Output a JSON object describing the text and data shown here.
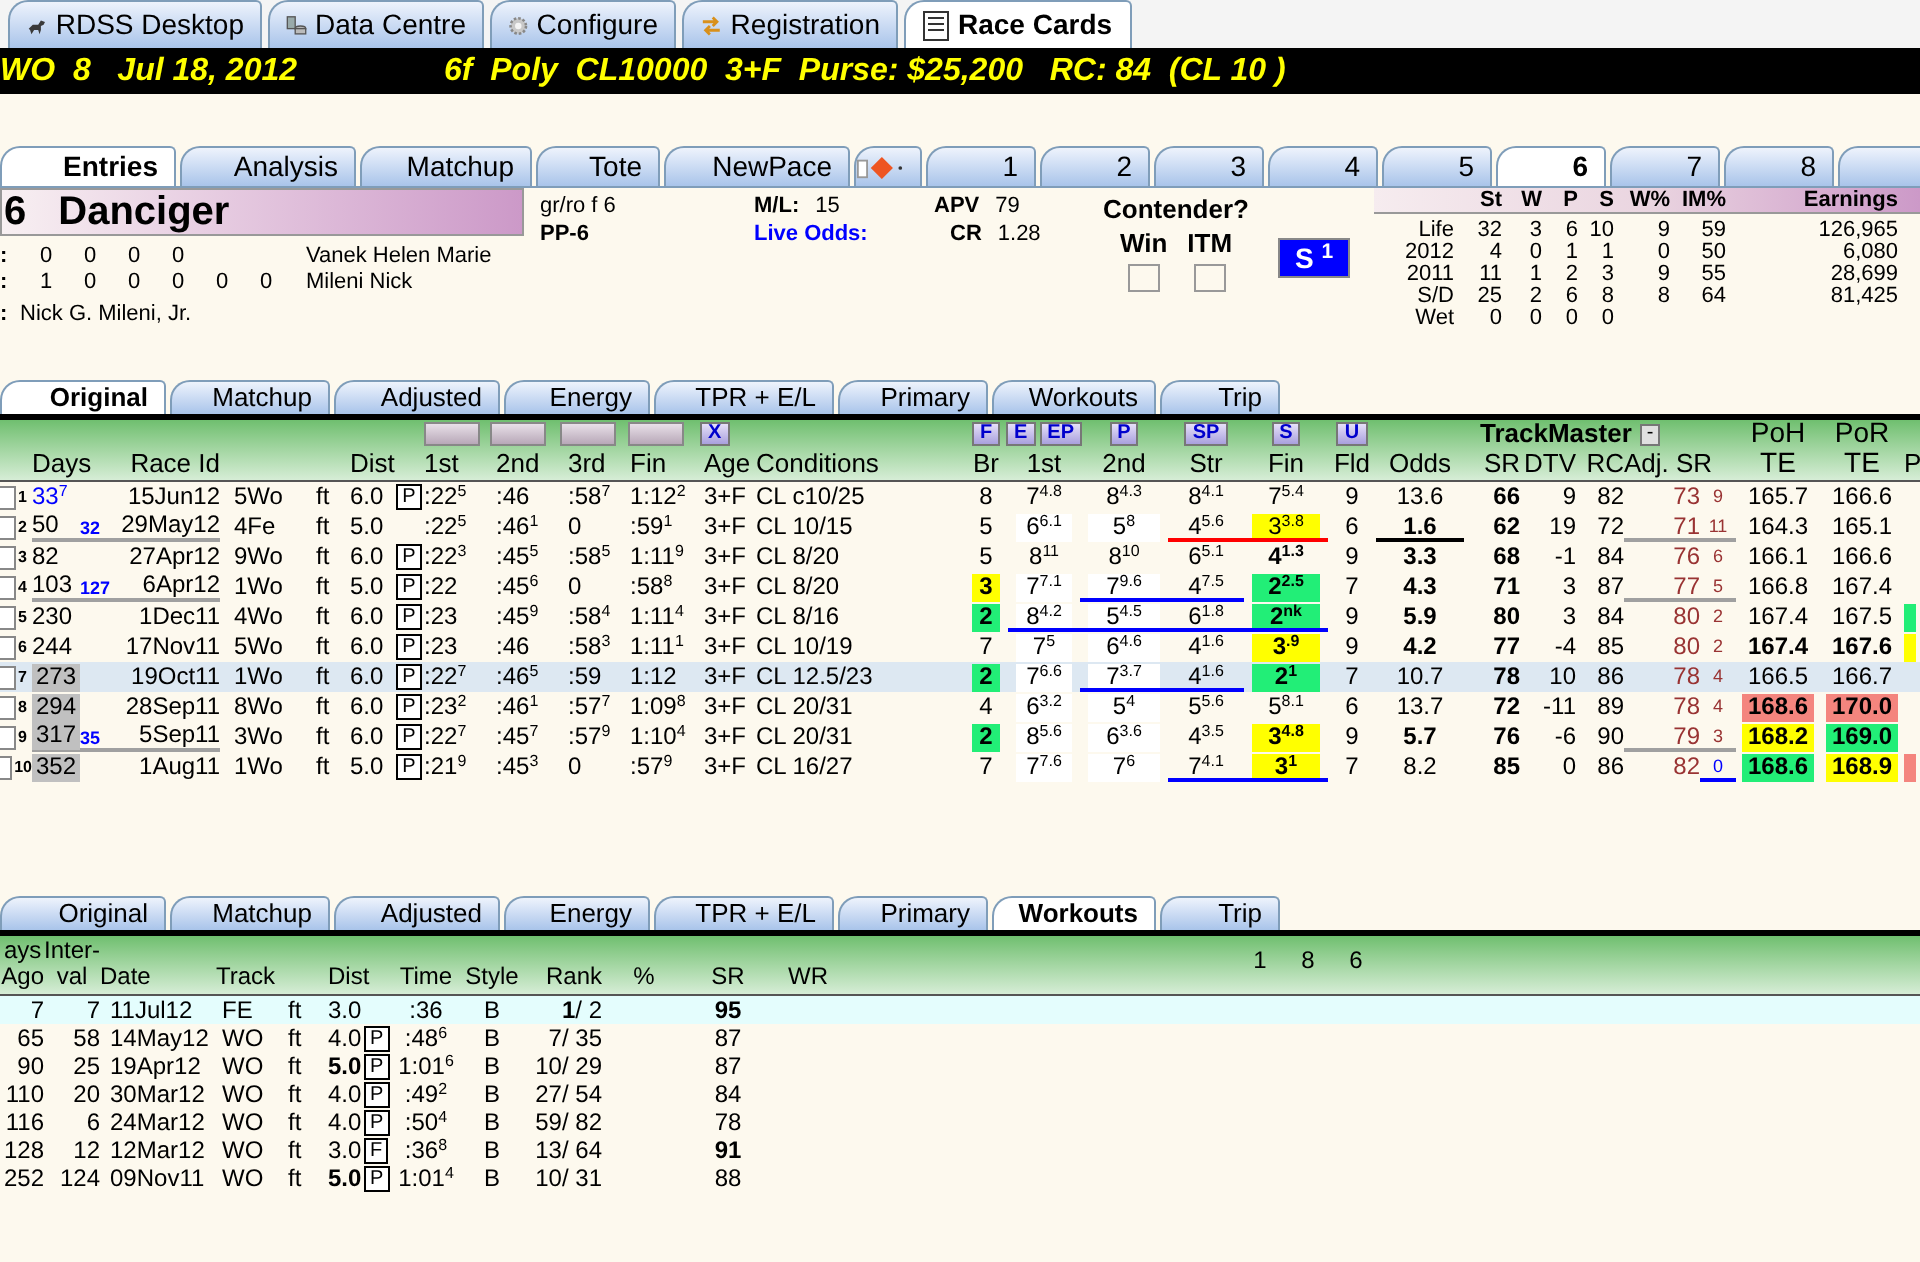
{
  "app_tabs": [
    {
      "label": "RDSS Desktop",
      "selected": false,
      "kind": "horse"
    },
    {
      "label": "Data Centre",
      "selected": false,
      "kind": "database"
    },
    {
      "label": "Configure",
      "selected": false,
      "kind": "gear"
    },
    {
      "label": "Registration",
      "selected": false,
      "kind": "arrows"
    },
    {
      "label": "Race Cards",
      "selected": true,
      "kind": "document"
    }
  ],
  "race_header": {
    "left": "WO  8   Jul 18, 2012",
    "right": "6f  Poly  CL10000  3+F  Purse: $25,200   RC: 84  (CL 10 )"
  },
  "entry_tabs": [
    {
      "kind": "text",
      "label": "Entries",
      "selected": true
    },
    {
      "kind": "text",
      "label": "Analysis",
      "selected": false
    },
    {
      "kind": "text",
      "label": "Matchup",
      "selected": false
    },
    {
      "kind": "text",
      "label": "Tote",
      "selected": false
    },
    {
      "kind": "text",
      "label": "NewPace",
      "selected": false
    },
    {
      "kind": "icon",
      "selected": false
    }
  ],
  "horse_tabs": [
    {
      "label": "1",
      "selected": false
    },
    {
      "label": "2",
      "selected": false
    },
    {
      "label": "3",
      "selected": false
    },
    {
      "label": "4",
      "selected": false
    },
    {
      "label": "5",
      "selected": false
    },
    {
      "label": "6",
      "selected": true
    },
    {
      "label": "7",
      "selected": false
    },
    {
      "label": "8",
      "selected": false
    },
    {
      "selected": false
    }
  ],
  "horse": {
    "number": "6",
    "name": "Danciger",
    "record_lines": [
      {
        "label": ":",
        "values": [
          "0",
          "0",
          "0",
          "0"
        ],
        "person": "Vanek Helen Marie"
      },
      {
        "label": ":",
        "values": [
          "1",
          "0",
          "0",
          "0",
          "0",
          "0"
        ],
        "person": "Mileni Nick"
      },
      {
        "label": ":",
        "person": "Nick G. Mileni, Jr."
      }
    ],
    "description": "gr/ro f 6",
    "post": "PP-6",
    "odds": [
      {
        "label": "M/L:",
        "value": "15"
      },
      {
        "label": "Live Odds:",
        "color": "#0000ff"
      }
    ],
    "ratings": [
      {
        "label": "APV",
        "value": "79"
      },
      {
        "label": "CR",
        "value": "1.28"
      }
    ],
    "contender": {
      "title": "Contender?",
      "options": [
        {
          "label": "Win",
          "checked": false
        },
        {
          "label": "ITM",
          "checked": false
        }
      ]
    },
    "style_badge": "S $^{1}$"
  },
  "career": {
    "columns": [
      "St",
      "W",
      "P",
      "S",
      "W%",
      "IM%",
      "Earnings"
    ],
    "rows": [
      {
        "label": "Life",
        "values": [
          "32",
          "3",
          "6",
          "10",
          "9",
          "59",
          "126,965"
        ]
      },
      {
        "label": "2012",
        "values": [
          "4",
          "0",
          "1",
          "1",
          "0",
          "50",
          "6,080"
        ]
      },
      {
        "label": "2011",
        "values": [
          "11",
          "1",
          "2",
          "3",
          "9",
          "55",
          "28,699"
        ]
      },
      {
        "label": "S/D",
        "values": [
          "25",
          "2",
          "6",
          "8",
          "8",
          "64",
          "81,425"
        ]
      },
      {
        "label": "Wet",
        "values": [
          "0",
          "0",
          "0",
          "0"
        ]
      }
    ]
  },
  "past_tabs": [
    {
      "label": "Original",
      "selected": true
    },
    {
      "label": "Matchup",
      "selected": false
    },
    {
      "label": "Adjusted",
      "selected": false
    },
    {
      "label": "Energy",
      "selected": false
    },
    {
      "label": "TPR + E/L",
      "selected": false
    },
    {
      "label": "Primary",
      "selected": false
    },
    {
      "label": "Workouts",
      "selected": false
    },
    {
      "label": "Trip",
      "selected": false
    }
  ],
  "entries": {
    "header": {
      "days": "Days",
      "race_id": "Race Id",
      "dist": "Dist",
      "first_call": "1st",
      "second_call": "2nd",
      "third_call": "3rd",
      "final_time": "Fin",
      "age": "Age",
      "conditions": "Conditions",
      "br": "Br",
      "pos_1st": "1st",
      "pos_2nd": "2nd",
      "pos_str": "Str",
      "pos_fin": "Fin",
      "fld": "Fld",
      "odds": "Odds",
      "sr": "SR",
      "dtv": "DTV",
      "rc": "RC",
      "adj_sr": "Adj. SR",
      "poh": "PoH\nTE",
      "por": "PoR\nTE",
      "p_rank": "P"
    },
    "header_buttons": {
      "age": [
        "X"
      ],
      "br": [
        "F"
      ],
      "pos_1st": [
        "E",
        "EP"
      ],
      "pos_2nd": [
        "P"
      ],
      "pos_str": [
        "SP"
      ],
      "pos_fin": [
        "S"
      ],
      "fld": [
        "U"
      ]
    },
    "group_label": "TrackMaster",
    "group_button": "-",
    "rows": [
      {
        "num": "1",
        "checked": false,
        "selected": false,
        "days": {
          "text": "33$^{7}$",
          "text_style": {
            "color": "#0000ff"
          }
        },
        "race_id": "15Jun12",
        "track": "5Wo",
        "surf": "ft",
        "dist": "6.0",
        "p_box": "P",
        "first_call": ":22$^{5}$",
        "second_call": ":46",
        "third_call": ":58$^{7}$",
        "final_time": "1:12$^{2}$",
        "age": "3+F",
        "conditions": "CL c10/25",
        "br": "8",
        "pos_1st": "7$^{4.8}$",
        "pos_2nd": "8$^{4.3}$",
        "pos_str": "8$^{4.1}$",
        "pos_fin": "7$^{5.4}$",
        "fld": "9",
        "odds": "13.6",
        "sr": "66",
        "dtv": "9",
        "rc": "82",
        "adj_sr": "73",
        "adj_n": "9",
        "poh": "165.7",
        "por": "166.6"
      },
      {
        "num": "2",
        "checked": false,
        "selected": false,
        "days": "50",
        "gap": "32",
        "race_id": "29May12",
        "track": "4Fe",
        "surf": "ft",
        "dist": "5.0",
        "first_call": ":22$^{5}$",
        "second_call": ":46$^{1}$",
        "third_call": "0",
        "final_time": ":59$^{1}$",
        "age": "3+F",
        "conditions": "CL 10/15",
        "br": "5",
        "pos_1st": {
          "text": "6$^{6.1}$",
          "color": "#ffffff"
        },
        "pos_2nd": {
          "text": "5$^{8}$",
          "color": "#ffffff"
        },
        "pos_str": {
          "text": "4$^{5.6}$",
          "underline": {
            "color": "#ff0000"
          }
        },
        "pos_fin": {
          "text": "3$^{3.8}$",
          "color": "#ffff00",
          "underline": {
            "color": "#ff0000"
          }
        },
        "fld": "6",
        "odds": {
          "text": "1.6",
          "bold": true,
          "underline": {
            "color": "#000000"
          }
        },
        "sr": "62",
        "dtv": "19",
        "rc": "72",
        "adj_sr": {
          "text": "71",
          "underline": {
            "color": "#a0a0a0"
          }
        },
        "adj_n": {
          "text": "11",
          "underline": {
            "color": "#a0a0a0"
          }
        },
        "poh": "164.3",
        "por": "165.1"
      },
      {
        "num": "3",
        "checked": false,
        "selected": false,
        "days": "82",
        "race_id": "27Apr12",
        "track": "9Wo",
        "surf": "ft",
        "dist": "6.0",
        "p_box": "P",
        "first_call": ":22$^{3}$",
        "second_call": ":45$^{5}$",
        "third_call": ":58$^{5}$",
        "final_time": "1:11$^{9}$",
        "age": "3+F",
        "conditions": "CL 8/20",
        "br": "5",
        "pos_1st": "8$^{11}$",
        "pos_2nd": "8$^{10}$",
        "pos_str": "6$^{5.1}$",
        "pos_fin": {
          "text": "4$^{1.3}$",
          "bold": true
        },
        "fld": "9",
        "odds": {
          "text": "3.3",
          "bold": true
        },
        "sr": "68",
        "dtv": "-1",
        "rc": "84",
        "adj_sr": "76",
        "adj_n": "6",
        "poh": "166.1",
        "por": "166.6"
      },
      {
        "num": "4",
        "checked": false,
        "selected": false,
        "days": "103",
        "gap": "127",
        "race_id": "6Apr12",
        "track": "1Wo",
        "surf": "ft",
        "dist": "5.0",
        "p_box": "P",
        "first_call": ":22",
        "second_call": ":45$^{6}$",
        "third_call": "0",
        "final_time": ":58$^{8}$",
        "age": "3+F",
        "conditions": "CL 8/20",
        "br": {
          "text": "3",
          "color": "#ffff00",
          "bold": true
        },
        "pos_1st": {
          "text": "7$^{7.1}$",
          "color": "#ffffff"
        },
        "pos_2nd": {
          "text": "7$^{9.6}$",
          "color": "#ffffff",
          "underline": {
            "color": "#0000ff"
          }
        },
        "pos_str": {
          "text": "4$^{7.5}$",
          "underline": {
            "color": "#0000ff"
          }
        },
        "pos_fin": {
          "text": "2$^{2.5}$",
          "color": "#22ee77",
          "bold": true
        },
        "fld": "7",
        "odds": {
          "text": "4.3",
          "bold": true
        },
        "sr": "71",
        "dtv": "3",
        "rc": "87",
        "adj_sr": {
          "text": "77",
          "underline": {
            "color": "#a0a0a0"
          }
        },
        "adj_n": {
          "text": "5",
          "underline": {
            "color": "#a0a0a0"
          }
        },
        "poh": "166.8",
        "por": "167.4"
      },
      {
        "num": "5",
        "checked": false,
        "selected": false,
        "days": "230",
        "race_id": "1Dec11",
        "track": "4Wo",
        "surf": "ft",
        "dist": "6.0",
        "p_box": "P",
        "first_call": ":23",
        "second_call": ":45$^{9}$",
        "third_call": ":58$^{4}$",
        "final_time": "1:11$^{4}$",
        "age": "3+F",
        "conditions": "CL 8/16",
        "br": {
          "text": "2",
          "color": "#22ee77",
          "bold": true
        },
        "pos_1st": {
          "text": "8$^{4.2}$",
          "color": "#ffffff",
          "underline": {
            "color": "#0000ff"
          }
        },
        "pos_2nd": {
          "text": "5$^{4.5}$",
          "color": "#ffffff",
          "underline": {
            "color": "#0000ff"
          }
        },
        "pos_str": {
          "text": "6$^{1.8}$",
          "underline": {
            "color": "#0000ff"
          }
        },
        "pos_fin": {
          "text": "2$^{nk}$",
          "color": "#22ee77",
          "bold": true,
          "underline": {
            "color": "#0000ff"
          }
        },
        "fld": "9",
        "odds": {
          "text": "5.9",
          "bold": true
        },
        "sr": "80",
        "dtv": "3",
        "rc": "84",
        "adj_sr": "80",
        "adj_n": "2",
        "poh": "167.4",
        "por": "167.5",
        "p_rank": {
          "color": "#22ee77"
        }
      },
      {
        "num": "6",
        "checked": false,
        "selected": false,
        "days": "244",
        "race_id": "17Nov11",
        "track": "5Wo",
        "surf": "ft",
        "dist": "6.0",
        "p_box": "P",
        "first_call": ":23",
        "second_call": ":46",
        "third_call": ":58$^{3}$",
        "final_time": "1:11$^{1}$",
        "age": "3+F",
        "conditions": "CL 10/19",
        "br": "7",
        "pos_1st": {
          "text": "7$^{5}$",
          "color": "#ffffff"
        },
        "pos_2nd": {
          "text": "6$^{4.6}$",
          "color": "#ffffff"
        },
        "pos_str": "4$^{1.6}$",
        "pos_fin": {
          "text": "3$^{.9}$",
          "color": "#ffff00",
          "bold": true
        },
        "fld": "9",
        "odds": {
          "text": "4.2",
          "bold": true
        },
        "sr": "77",
        "dtv": "-4",
        "rc": "85",
        "adj_sr": "80",
        "adj_n": "2",
        "poh": {
          "text": "167.4",
          "bold": true
        },
        "por": {
          "text": "167.6",
          "bold": true
        },
        "p_rank": {
          "color": "#ffff00"
        }
      },
      {
        "num": "7",
        "checked": false,
        "selected": true,
        "days": {
          "text": "273",
          "color": "#c0c0c0"
        },
        "race_id": "19Oct11",
        "track": "1Wo",
        "surf": "ft",
        "dist": "6.0",
        "p_box": "P",
        "first_call": ":22$^{7}$",
        "second_call": ":46$^{5}$",
        "third_call": ":59",
        "final_time": "1:12",
        "age": "3+F",
        "conditions": "CL 12.5/23",
        "br": {
          "text": "2",
          "color": "#22ee77",
          "bold": true
        },
        "pos_1st": {
          "text": "7$^{6.6}$",
          "color": "#ffffff"
        },
        "pos_2nd": {
          "text": "7$^{3.7}$",
          "color": "#ffffff",
          "underline": {
            "color": "#0000ff"
          }
        },
        "pos_str": {
          "text": "4$^{1.6}$",
          "underline": {
            "color": "#0000ff"
          }
        },
        "pos_fin": {
          "text": "2$^{1}$",
          "color": "#22ee77",
          "bold": true
        },
        "fld": "7",
        "odds": "10.7",
        "sr": "78",
        "dtv": "10",
        "rc": "86",
        "adj_sr": "78",
        "adj_n": "4",
        "poh": "166.5",
        "por": "166.7"
      },
      {
        "num": "8",
        "checked": false,
        "selected": false,
        "days": {
          "text": "294",
          "color": "#c0c0c0"
        },
        "race_id": "28Sep11",
        "track": "8Wo",
        "surf": "ft",
        "dist": "6.0",
        "p_box": "P",
        "first_call": ":23$^{2}$",
        "second_call": ":46$^{1}$",
        "third_call": ":57$^{7}$",
        "final_time": "1:09$^{8}$",
        "age": "3+F",
        "conditions": "CL 20/31",
        "br": "4",
        "pos_1st": {
          "text": "6$^{3.2}$",
          "color": "#ffffff"
        },
        "pos_2nd": {
          "text": "5$^{4}$",
          "color": "#ffffff"
        },
        "pos_str": "5$^{5.6}$",
        "pos_fin": "5$^{8.1}$",
        "fld": "6",
        "odds": "13.7",
        "sr": "72",
        "dtv": "-11",
        "rc": "89",
        "adj_sr": "78",
        "adj_n": "4",
        "poh": {
          "text": "168.6",
          "color": "#f4857e",
          "bold": true
        },
        "por": {
          "text": "170.0",
          "color": "#f4857e",
          "bold": true
        }
      },
      {
        "num": "9",
        "checked": false,
        "selected": false,
        "days": {
          "text": "317",
          "color": "#c0c0c0"
        },
        "gap": "35",
        "race_id": "5Sep11",
        "track": "3Wo",
        "surf": "ft",
        "dist": "6.0",
        "p_box": "P",
        "first_call": ":22$^{7}$",
        "second_call": ":45$^{7}$",
        "third_call": ":57$^{9}$",
        "final_time": "1:10$^{4}$",
        "age": "3+F",
        "conditions": "CL 20/31",
        "br": {
          "text": "2",
          "color": "#22ee77",
          "bold": true
        },
        "pos_1st": {
          "text": "8$^{5.6}$",
          "color": "#ffffff"
        },
        "pos_2nd": {
          "text": "6$^{3.6}$",
          "color": "#ffffff"
        },
        "pos_str": "4$^{3.5}$",
        "pos_fin": {
          "text": "3$^{4.8}$",
          "color": "#ffff00",
          "bold": true
        },
        "fld": "9",
        "odds": {
          "text": "5.7",
          "bold": true
        },
        "sr": "76",
        "dtv": "-6",
        "rc": "90",
        "adj_sr": {
          "text": "79",
          "underline": {
            "color": "#a0a0a0"
          }
        },
        "adj_n": {
          "text": "3",
          "underline": {
            "color": "#a0a0a0"
          }
        },
        "poh": {
          "text": "168.2",
          "color": "#ffff00",
          "bold": true
        },
        "por": {
          "text": "169.0",
          "color": "#22ee77",
          "bold": true
        }
      },
      {
        "num": "10",
        "checked": false,
        "selected": false,
        "days": {
          "text": "352",
          "color": "#c0c0c0"
        },
        "race_id": "1Aug11",
        "track": "1Wo",
        "surf": "ft",
        "dist": "5.0",
        "p_box": "P",
        "first_call": ":21$^{9}$",
        "second_call": ":45$^{3}$",
        "third_call": "0",
        "final_time": ":57$^{9}$",
        "age": "3+F",
        "conditions": "CL 16/27",
        "br": "7",
        "pos_1st": {
          "text": "7$^{7.6}$",
          "color": "#ffffff"
        },
        "pos_2nd": {
          "text": "7$^{6}$",
          "color": "#ffffff"
        },
        "pos_str": {
          "text": "7$^{4.1}$",
          "underline": {
            "color": "#0000ff"
          }
        },
        "pos_fin": {
          "text": "3$^{1}$",
          "color": "#ffff00",
          "bold": true,
          "underline": {
            "color": "#0000ff"
          }
        },
        "fld": "7",
        "odds": "8.2",
        "sr": "85",
        "dtv": "0",
        "rc": "86",
        "adj_sr": "82",
        "adj_n": {
          "text": "0",
          "text_style": {
            "color": "#0000ff"
          },
          "underline": {
            "color": "#0000ff"
          }
        },
        "poh": {
          "text": "168.6",
          "color": "#22ee77",
          "bold": true
        },
        "por": {
          "text": "168.9",
          "color": "#ffff00",
          "bold": true
        },
        "p_rank": {
          "color": "#f4857e"
        }
      }
    ]
  },
  "workout_tabs": [
    {
      "label": "Original",
      "selected": false
    },
    {
      "label": "Matchup",
      "selected": false
    },
    {
      "label": "Adjusted",
      "selected": false
    },
    {
      "label": "Energy",
      "selected": false
    },
    {
      "label": "TPR + E/L",
      "selected": false
    },
    {
      "label": "Primary",
      "selected": false
    },
    {
      "label": "Workouts",
      "selected": true
    },
    {
      "label": "Trip",
      "selected": false
    }
  ],
  "workouts": {
    "header": {
      "days_ago": "ays\nAgo",
      "interval": "Inter-\nval",
      "date": "Date",
      "track": "Track",
      "dist": "Dist",
      "time": "Time",
      "style": "Style",
      "rank": "Rank",
      "pct": "%",
      "sr": "SR",
      "wr": "WR"
    },
    "extra_header": [
      "1",
      "8",
      "6"
    ],
    "rows": [
      {
        "selected": true,
        "days_ago": "7",
        "interval": "7",
        "date": "11Jul12",
        "track": "FE",
        "surf": "ft",
        "dist": "3.0",
        "time": ":36",
        "style": "B",
        "rank": "**1**/ 2",
        "sr": {
          "text": "95",
          "bold": true
        }
      },
      {
        "selected": false,
        "days_ago": "65",
        "interval": "58",
        "date": "14May12",
        "track": "WO",
        "surf": "ft",
        "dist": "4.0",
        "box": "P",
        "time": ":48$^{6}$",
        "style": "B",
        "rank": "7/ 35",
        "sr": "87"
      },
      {
        "selected": false,
        "days_ago": "90",
        "interval": "25",
        "date": "19Apr12",
        "track": "WO",
        "surf": "ft",
        "dist": {
          "text": "5.0",
          "bold": true
        },
        "box": "P",
        "time": "1:01$^{6}$",
        "style": "B",
        "rank": "10/ 29",
        "sr": "87"
      },
      {
        "selected": false,
        "days_ago": "110",
        "interval": "20",
        "date": "30Mar12",
        "track": "WO",
        "surf": "ft",
        "dist": "4.0",
        "box": "P",
        "time": ":49$^{2}$",
        "style": "B",
        "rank": "27/ 54",
        "sr": "84"
      },
      {
        "selected": false,
        "days_ago": "116",
        "interval": "6",
        "date": "24Mar12",
        "track": "WO",
        "surf": "ft",
        "dist": "4.0",
        "box": "P",
        "time": ":50$^{4}$",
        "style": "B",
        "rank": "59/ 82",
        "sr": "78"
      },
      {
        "selected": false,
        "days_ago": "128",
        "interval": "12",
        "date": "12Mar12",
        "track": "WO",
        "surf": "ft",
        "dist": "3.0",
        "box": "F",
        "time": ":36$^{8}$",
        "style": "B",
        "rank": "13/ 64",
        "sr": {
          "text": "91",
          "bold": true
        }
      },
      {
        "selected": false,
        "days_ago": "252",
        "interval": "124",
        "date": "09Nov11",
        "track": "WO",
        "surf": "ft",
        "dist": {
          "text": "5.0",
          "bold": true
        },
        "box": "P",
        "time": "1:01$^{4}$",
        "style": "B",
        "rank": "10/ 31",
        "sr": "88"
      }
    ]
  }
}
